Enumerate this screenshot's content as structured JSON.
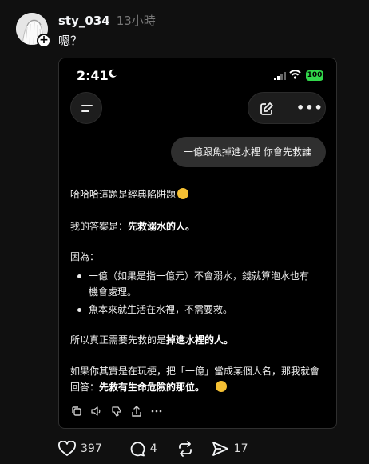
{
  "post": {
    "username": "sty_034",
    "time": "13小時",
    "text": "嗯？",
    "avatar_icon": "avatar-image",
    "follow_icon": "+"
  },
  "screenshot": {
    "status": {
      "time": "2:41",
      "battery": "100"
    },
    "user_message": "一億跟魚掉進水裡 你會先救誰",
    "reply": {
      "p1": "哈哈哈這題是經典陷阱題",
      "p2_prefix": "我的答案是：",
      "p2_bold": "先救溺水的人。",
      "p3": "因為：",
      "bullet1": "一億（如果是指一億元）不會溺水，錢就算泡水也有機會處理。",
      "bullet2": "魚本來就生活在水裡，不需要救。",
      "p4_prefix": "所以真正需要先救的是",
      "p4_bold": "掉進水裡的人。",
      "p5_line1": "如果你其實是在玩梗，把「一億」當成某個人名，那我就會",
      "p5_prefix": "回答：",
      "p5_bold": "先救有生命危險的那位。"
    }
  },
  "actions": {
    "likes": "397",
    "comments": "4",
    "shares": "17"
  },
  "colors": {
    "background": "#101010",
    "battery": "#32d74b",
    "bubble": "#2f2f2f"
  }
}
